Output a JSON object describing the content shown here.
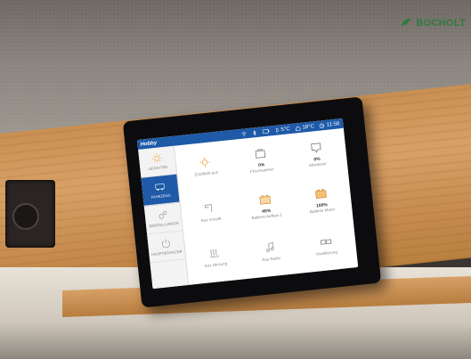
{
  "branding": {
    "watermark": "BOCHOLT"
  },
  "device": {
    "topbar": {
      "brand": "Hobby",
      "indicators": [
        {
          "icon": "wifi-icon",
          "text": ""
        },
        {
          "icon": "bluetooth-icon",
          "text": ""
        },
        {
          "icon": "battery-icon",
          "text": ""
        },
        {
          "icon": "outside-temp-icon",
          "text": "5°C"
        },
        {
          "icon": "inside-temp-icon",
          "text": "18°C"
        },
        {
          "icon": "clock-icon",
          "text": "11:58"
        }
      ]
    },
    "sidebar": [
      {
        "label": "Leuchten",
        "icon": "sun-icon",
        "active": false
      },
      {
        "label": "Fahrzeug",
        "icon": "vehicle-icon",
        "active": true
      },
      {
        "label": "Einstellungen",
        "icon": "settings-icon",
        "active": false
      },
      {
        "label": "Hauptschalter",
        "icon": "power-icon",
        "active": false
      }
    ],
    "tiles": [
      {
        "icon": "light-icon",
        "value": "",
        "label": "Zündlicht aus"
      },
      {
        "icon": "water-tank-icon",
        "value": "0%",
        "label": "Frischwasser"
      },
      {
        "icon": "waste-tank-icon",
        "value": "0%",
        "label": "Abwasser"
      },
      {
        "icon": "awning-icon",
        "value": "",
        "label": "Aus Vorzelt"
      },
      {
        "icon": "battery-body-icon",
        "value": "45%",
        "label": "Batterie Aufbau 1"
      },
      {
        "icon": "battery-motor-icon",
        "value": "100%",
        "label": "Batterie Motor"
      },
      {
        "icon": "heater-icon",
        "value": "",
        "label": "Aus Heizung"
      },
      {
        "icon": "music-icon",
        "value": "",
        "label": "Aus Radio"
      },
      {
        "icon": "level-icon",
        "value": "",
        "label": "Nivellierung"
      }
    ]
  },
  "colors": {
    "accent": "#1e5aa8",
    "brand_green": "#2f7a3e"
  }
}
